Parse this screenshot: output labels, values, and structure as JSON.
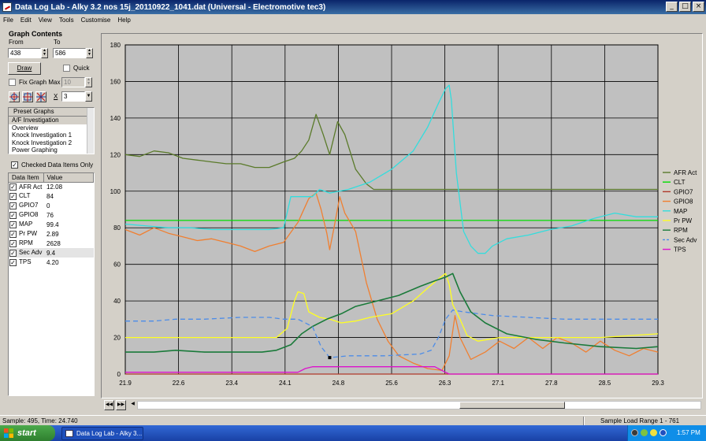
{
  "window": {
    "title": "Data Log Lab - Alky 3.2 nos 15j_20110922_1041.dat (Universal - Electromotive tec3)"
  },
  "menu": [
    "File",
    "Edit",
    "View",
    "Tools",
    "Customise",
    "Help"
  ],
  "graph_contents": {
    "heading": "Graph Contents",
    "from_label": "From",
    "to_label": "To",
    "from_value": "438",
    "to_value": "586",
    "draw_label": "Draw",
    "quick_label": "Quick",
    "fix_graph_max_label": "Fix Graph Max",
    "fix_graph_max_value": "10",
    "x_label": "X",
    "x_value": "3"
  },
  "preset_graphs": {
    "header": "Preset Graphs",
    "items": [
      "A/F Investigation",
      "Overview",
      "Knock Investigation 1",
      "Knock Investigation 2",
      "Power Graphing"
    ]
  },
  "checked_only_label": "Checked Data Items Only",
  "data_table": {
    "headers": [
      "Data Item",
      "Value"
    ],
    "rows": [
      {
        "item": "AFR Act",
        "value": "12.08"
      },
      {
        "item": "CLT",
        "value": "84"
      },
      {
        "item": "GPIO7",
        "value": "0"
      },
      {
        "item": "GPIO8",
        "value": "76"
      },
      {
        "item": "MAP",
        "value": "99.4"
      },
      {
        "item": "Pr PW",
        "value": "2.89"
      },
      {
        "item": "RPM",
        "value": "2628"
      },
      {
        "item": "Sec Adv",
        "value": "9.4"
      },
      {
        "item": "TPS",
        "value": "4.20"
      }
    ]
  },
  "status": {
    "left": "Sample: 495, Time: 24.740",
    "right": "Sample Load Range 1 - 761"
  },
  "taskbar": {
    "start": "start",
    "item": "Data Log Lab - Alky 3...",
    "clock": "1:57 PM"
  },
  "chart_data": {
    "type": "line",
    "x_ticks": [
      "21.9",
      "22.6",
      "23.4",
      "24.1",
      "24.8",
      "25.6",
      "26.3",
      "27.1",
      "27.8",
      "28.5",
      "29.3"
    ],
    "y_ticks": [
      "0",
      "20",
      "40",
      "60",
      "80",
      "100",
      "120",
      "140",
      "160",
      "180"
    ],
    "xlim": [
      21.9,
      29.3
    ],
    "ylim": [
      0,
      180
    ],
    "grid": true,
    "legend_position": "right",
    "cursor_marker": {
      "x": 24.74,
      "y": 9
    },
    "series": [
      {
        "name": "AFR Act",
        "color": "#5a7a2a",
        "dash": false,
        "points": [
          [
            21.9,
            120
          ],
          [
            22.1,
            119
          ],
          [
            22.3,
            122
          ],
          [
            22.5,
            121
          ],
          [
            22.7,
            118
          ],
          [
            22.9,
            117
          ],
          [
            23.1,
            116
          ],
          [
            23.3,
            115
          ],
          [
            23.5,
            115
          ],
          [
            23.7,
            113
          ],
          [
            23.9,
            113
          ],
          [
            24.1,
            116
          ],
          [
            24.25,
            118
          ],
          [
            24.35,
            122
          ],
          [
            24.45,
            128
          ],
          [
            24.55,
            142
          ],
          [
            24.65,
            131
          ],
          [
            24.74,
            120
          ],
          [
            24.85,
            138
          ],
          [
            24.95,
            131
          ],
          [
            25.1,
            112
          ],
          [
            25.25,
            104
          ],
          [
            25.35,
            101
          ],
          [
            25.6,
            101
          ],
          [
            26.3,
            101
          ],
          [
            27.0,
            101
          ],
          [
            28.0,
            101
          ],
          [
            29.3,
            101
          ]
        ]
      },
      {
        "name": "CLT",
        "color": "#00dd00",
        "dash": false,
        "points": [
          [
            21.9,
            84
          ],
          [
            29.3,
            84
          ]
        ]
      },
      {
        "name": "GPIO7",
        "color": "#b0382a",
        "dash": false,
        "points": [
          [
            21.9,
            0
          ],
          [
            29.3,
            0
          ]
        ]
      },
      {
        "name": "GPIO8",
        "color": "#f07f30",
        "dash": false,
        "points": [
          [
            21.9,
            79
          ],
          [
            22.1,
            76
          ],
          [
            22.3,
            80
          ],
          [
            22.5,
            77
          ],
          [
            22.7,
            75
          ],
          [
            22.9,
            73
          ],
          [
            23.1,
            74
          ],
          [
            23.3,
            72
          ],
          [
            23.5,
            70
          ],
          [
            23.7,
            67
          ],
          [
            23.9,
            70
          ],
          [
            24.1,
            72
          ],
          [
            24.3,
            83
          ],
          [
            24.45,
            96
          ],
          [
            24.55,
            99
          ],
          [
            24.62,
            90
          ],
          [
            24.7,
            77
          ],
          [
            24.74,
            68
          ],
          [
            24.8,
            80
          ],
          [
            24.88,
            97
          ],
          [
            24.95,
            88
          ],
          [
            25.1,
            78
          ],
          [
            25.25,
            50
          ],
          [
            25.4,
            30
          ],
          [
            25.55,
            18
          ],
          [
            25.7,
            10
          ],
          [
            25.9,
            6
          ],
          [
            26.1,
            3
          ],
          [
            26.3,
            2
          ],
          [
            26.4,
            10
          ],
          [
            26.48,
            32
          ],
          [
            26.55,
            20
          ],
          [
            26.7,
            8
          ],
          [
            26.9,
            12
          ],
          [
            27.1,
            18
          ],
          [
            27.3,
            14
          ],
          [
            27.5,
            20
          ],
          [
            27.7,
            14
          ],
          [
            27.9,
            20
          ],
          [
            28.1,
            17
          ],
          [
            28.3,
            12
          ],
          [
            28.5,
            18
          ],
          [
            28.7,
            13
          ],
          [
            28.9,
            10
          ],
          [
            29.1,
            14
          ],
          [
            29.3,
            12
          ]
        ]
      },
      {
        "name": "MAP",
        "color": "#33dddd",
        "dash": false,
        "points": [
          [
            21.9,
            82
          ],
          [
            22.2,
            81
          ],
          [
            22.5,
            80
          ],
          [
            22.8,
            80
          ],
          [
            23.1,
            79
          ],
          [
            23.4,
            79
          ],
          [
            23.7,
            79
          ],
          [
            23.9,
            79
          ],
          [
            24.1,
            80
          ],
          [
            24.2,
            97
          ],
          [
            24.5,
            97
          ],
          [
            24.6,
            101
          ],
          [
            24.74,
            99
          ],
          [
            25.0,
            101
          ],
          [
            25.3,
            105
          ],
          [
            25.6,
            112
          ],
          [
            25.9,
            122
          ],
          [
            26.1,
            135
          ],
          [
            26.25,
            148
          ],
          [
            26.35,
            156
          ],
          [
            26.4,
            158
          ],
          [
            26.43,
            150
          ],
          [
            26.5,
            110
          ],
          [
            26.6,
            78
          ],
          [
            26.7,
            70
          ],
          [
            26.8,
            66
          ],
          [
            26.9,
            66
          ],
          [
            27.0,
            70
          ],
          [
            27.2,
            74
          ],
          [
            27.5,
            76
          ],
          [
            27.8,
            79
          ],
          [
            28.1,
            81
          ],
          [
            28.4,
            85
          ],
          [
            28.7,
            88
          ],
          [
            29.0,
            86
          ],
          [
            29.3,
            86
          ]
        ]
      },
      {
        "name": "Pr PW",
        "color": "#ffff22",
        "dash": false,
        "points": [
          [
            21.9,
            20
          ],
          [
            23.2,
            20
          ],
          [
            24.0,
            20
          ],
          [
            24.15,
            25
          ],
          [
            24.25,
            40
          ],
          [
            24.3,
            45
          ],
          [
            24.38,
            44
          ],
          [
            24.45,
            34
          ],
          [
            24.6,
            31
          ],
          [
            24.74,
            30
          ],
          [
            24.9,
            28
          ],
          [
            25.1,
            29
          ],
          [
            25.3,
            31
          ],
          [
            25.6,
            33
          ],
          [
            25.9,
            40
          ],
          [
            26.1,
            47
          ],
          [
            26.25,
            52
          ],
          [
            26.35,
            55
          ],
          [
            26.4,
            49
          ],
          [
            26.45,
            38
          ],
          [
            26.55,
            30
          ],
          [
            26.65,
            21
          ],
          [
            26.8,
            18
          ],
          [
            27.1,
            20
          ],
          [
            27.5,
            20
          ],
          [
            28.0,
            20
          ],
          [
            28.5,
            20
          ],
          [
            29.3,
            22
          ]
        ]
      },
      {
        "name": "RPM",
        "color": "#1a7a3a",
        "dash": false,
        "points": [
          [
            21.9,
            12
          ],
          [
            22.3,
            12
          ],
          [
            22.6,
            13
          ],
          [
            23.0,
            12
          ],
          [
            23.4,
            12
          ],
          [
            23.8,
            12
          ],
          [
            24.0,
            13
          ],
          [
            24.2,
            16
          ],
          [
            24.35,
            22
          ],
          [
            24.5,
            26
          ],
          [
            24.7,
            30
          ],
          [
            24.9,
            33
          ],
          [
            25.1,
            37
          ],
          [
            25.4,
            40
          ],
          [
            25.7,
            43
          ],
          [
            26.0,
            48
          ],
          [
            26.2,
            51
          ],
          [
            26.35,
            53
          ],
          [
            26.45,
            55
          ],
          [
            26.55,
            45
          ],
          [
            26.7,
            34
          ],
          [
            26.9,
            28
          ],
          [
            27.2,
            22
          ],
          [
            27.6,
            19
          ],
          [
            28.0,
            17
          ],
          [
            28.5,
            15
          ],
          [
            29.0,
            14
          ],
          [
            29.3,
            15
          ]
        ]
      },
      {
        "name": "Sec Adv",
        "color": "#4c8ce8",
        "dash": true,
        "points": [
          [
            21.9,
            29
          ],
          [
            22.3,
            29
          ],
          [
            22.6,
            30
          ],
          [
            23.0,
            30
          ],
          [
            23.5,
            31
          ],
          [
            23.9,
            31
          ],
          [
            24.1,
            30
          ],
          [
            24.3,
            30
          ],
          [
            24.5,
            26
          ],
          [
            24.62,
            15
          ],
          [
            24.74,
            9
          ],
          [
            25.0,
            10
          ],
          [
            25.5,
            10
          ],
          [
            26.0,
            11
          ],
          [
            26.15,
            13
          ],
          [
            26.25,
            20
          ],
          [
            26.35,
            30
          ],
          [
            26.45,
            35
          ],
          [
            26.6,
            34
          ],
          [
            27.0,
            32
          ],
          [
            27.5,
            31
          ],
          [
            28.0,
            30
          ],
          [
            28.5,
            30
          ],
          [
            29.3,
            30
          ]
        ]
      },
      {
        "name": "TPS",
        "color": "#dd11cc",
        "dash": false,
        "points": [
          [
            21.9,
            1
          ],
          [
            24.3,
            1
          ],
          [
            24.4,
            3
          ],
          [
            24.5,
            4
          ],
          [
            24.74,
            4
          ],
          [
            25.5,
            4
          ],
          [
            26.0,
            4
          ],
          [
            26.2,
            4
          ],
          [
            26.3,
            2
          ],
          [
            26.4,
            0
          ],
          [
            29.3,
            0
          ]
        ]
      }
    ]
  }
}
